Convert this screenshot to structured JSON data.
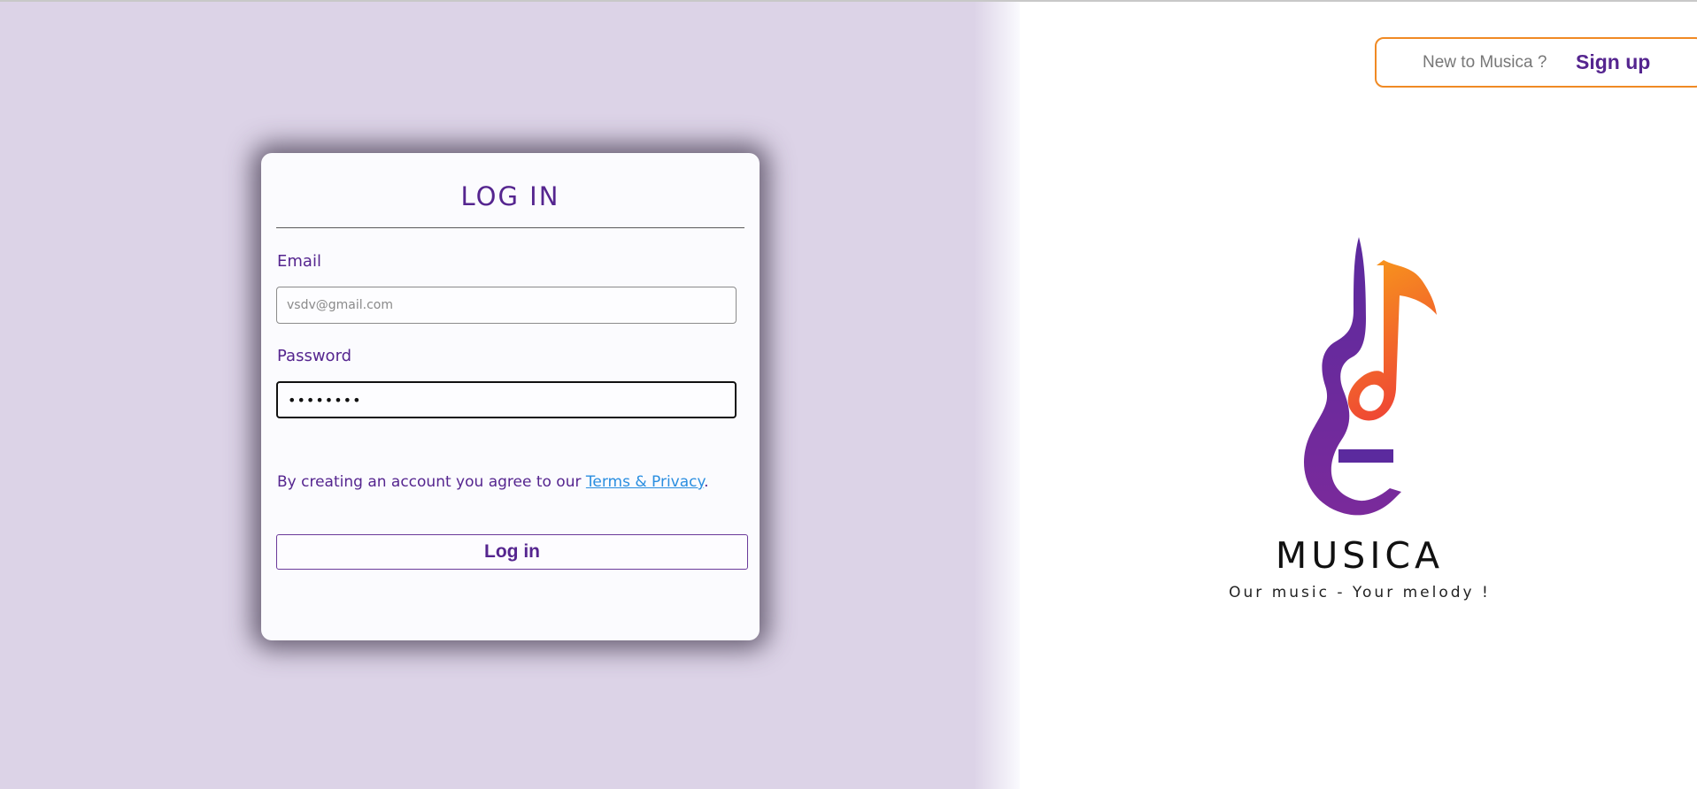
{
  "login_card": {
    "title": "LOG IN",
    "email": {
      "label": "Email",
      "placeholder": "vsdv@gmail.com",
      "value": ""
    },
    "password": {
      "label": "Password",
      "value": "••••••••"
    },
    "terms_text": "By creating an account you agree to our ",
    "terms_link": "Terms & Privacy",
    "terms_end": ".",
    "submit_label": "Log in"
  },
  "signup": {
    "prompt": "New to Musica ?",
    "link": "Sign up"
  },
  "brand": {
    "name": "MUSICA",
    "tagline": "Our music - Your melody !"
  },
  "colors": {
    "accent_purple": "#55258f",
    "left_background": "#dcd3e7",
    "signup_border": "#f08a24",
    "link_blue": "#2a8ee0",
    "logo_gradient_start": "#f7941d",
    "logo_gradient_end": "#ee4136"
  },
  "icons": {
    "logo": "guitar-music-note-logo-icon"
  }
}
